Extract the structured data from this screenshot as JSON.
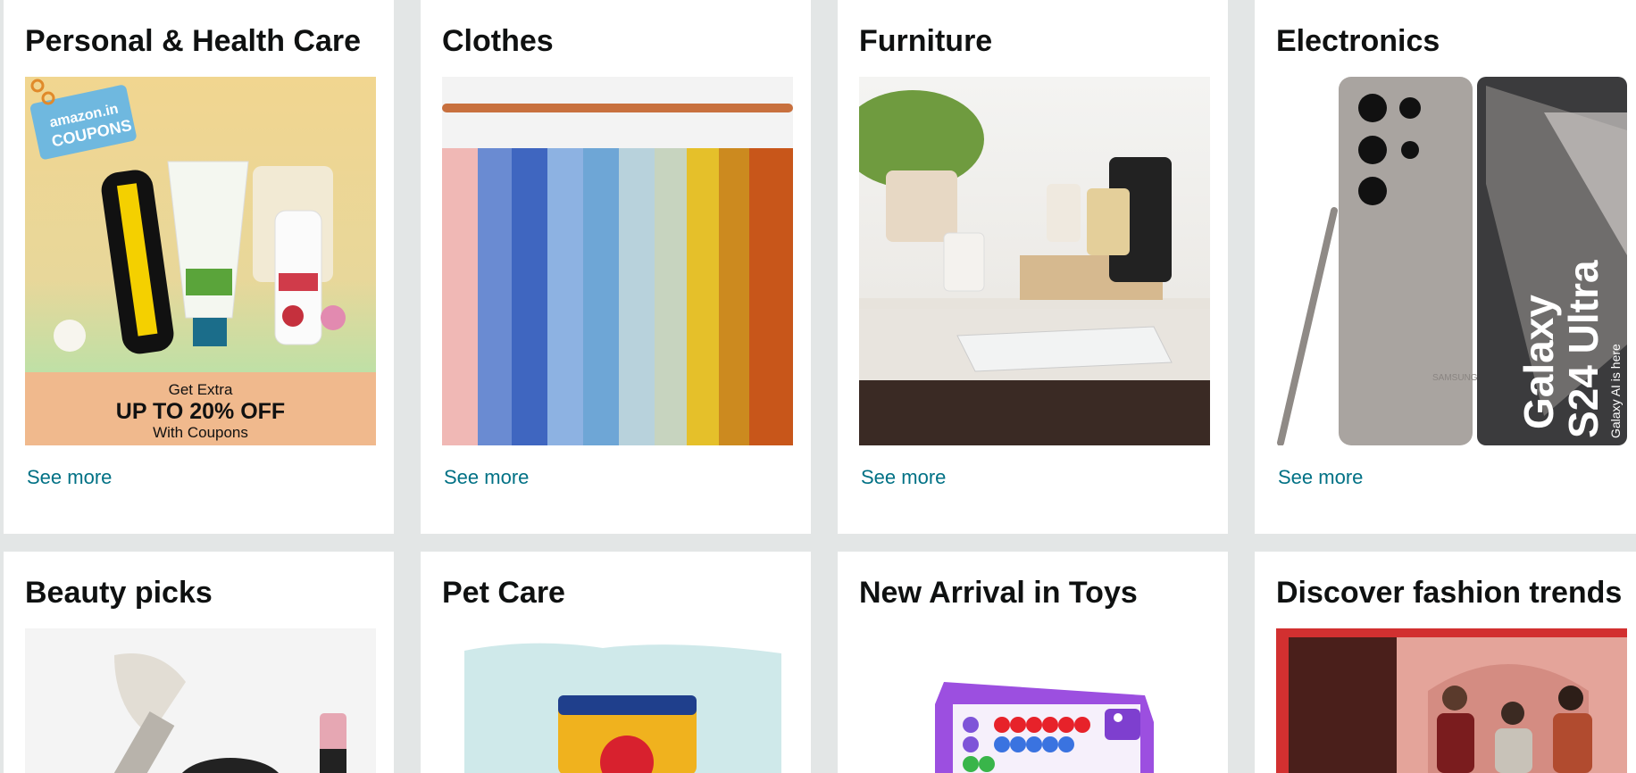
{
  "cards": [
    {
      "title": "Personal & Health Care",
      "link": "See more"
    },
    {
      "title": "Clothes",
      "link": "See more"
    },
    {
      "title": "Furniture",
      "link": "See more"
    },
    {
      "title": "Electronics",
      "link": "See more"
    },
    {
      "title": "Beauty picks"
    },
    {
      "title": "Pet Care"
    },
    {
      "title": "New Arrival in Toys"
    },
    {
      "title": "Discover fashion trends"
    }
  ],
  "coupon": {
    "brand": "amazon.in",
    "tag": "COUPONS",
    "line1": "Get Extra",
    "line2": "UP TO 20% OFF",
    "line3": "With Coupons"
  },
  "electronics_image": {
    "line1": "Galaxy",
    "line2": "S24 Ultra",
    "line3": "Galaxy AI is here",
    "brand": "SAMSUNG"
  },
  "colors": {
    "page_background": "#e3e6e6",
    "card_background": "#ffffff",
    "link": "#007185",
    "heading": "#0f1111"
  }
}
